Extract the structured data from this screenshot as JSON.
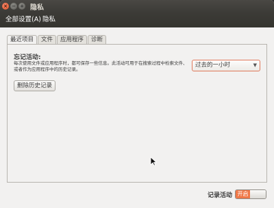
{
  "window": {
    "title": "隐私",
    "controls": {
      "close": "×",
      "minimize": "−",
      "maximize": "+"
    }
  },
  "toolbar": {
    "all_settings": "全部设置(A)",
    "current": "隐私"
  },
  "tabs": [
    {
      "label": "最近项目",
      "active": true
    },
    {
      "label": "文件",
      "active": false
    },
    {
      "label": "应用程序",
      "active": false
    },
    {
      "label": "诊断",
      "active": false
    }
  ],
  "recent": {
    "title": "忘记活动:",
    "description": "每次使用文件或应用程序时，都可保存一些信息。此活动可用于在搜索过程中检索文件、或者作为应用程序中的历史记录。",
    "period_select": {
      "value": "过去的一小时",
      "arrow": "▼"
    },
    "clear_button": "删除历史记录"
  },
  "footer": {
    "record_label": "记录活动",
    "toggle_on": "开启"
  },
  "colors": {
    "titlebar": "#3c3b37",
    "accent": "#f07746",
    "background": "#f2f1f0"
  }
}
